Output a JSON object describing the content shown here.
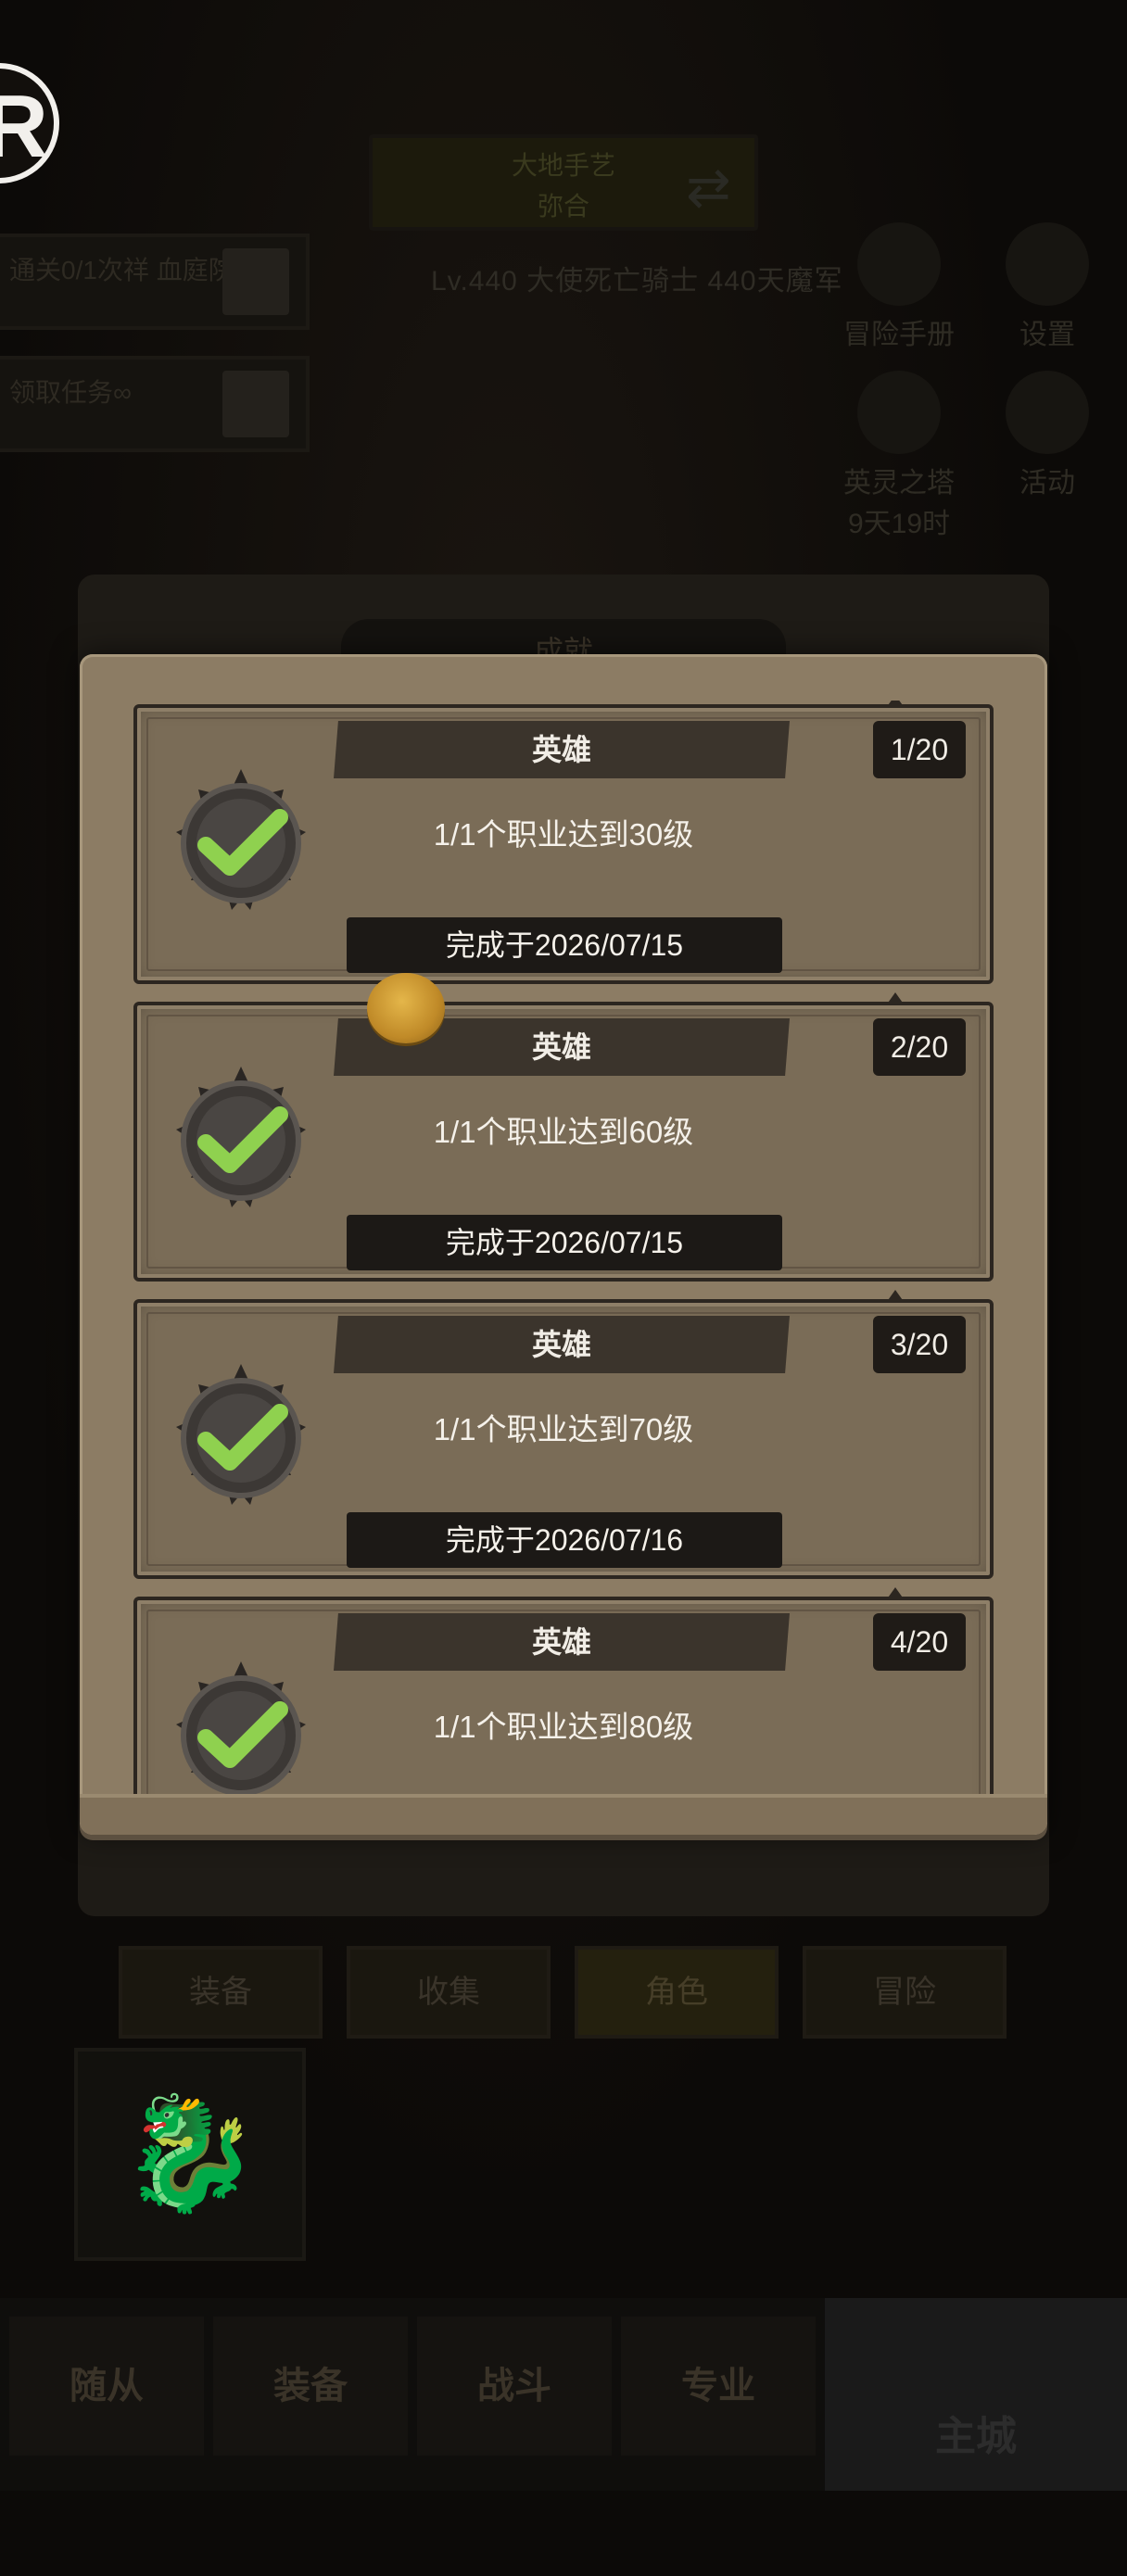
{
  "background": {
    "logo_letter": "R",
    "top_banner": [
      "大地手艺",
      "弥合"
    ],
    "quests": [
      "通关0/1次祥 血庭院",
      "领取任务∞"
    ],
    "hero_info": "Lv.440 大使死亡骑士   440天魔军",
    "side_buttons": [
      "冒险手册",
      "设置",
      "英灵之塔 9天19时",
      "活动"
    ],
    "panel_title": "成就",
    "nav_tabs": [
      {
        "label": "装备",
        "selected": false
      },
      {
        "label": "收集",
        "selected": false
      },
      {
        "label": "角色",
        "selected": true
      },
      {
        "label": "冒险",
        "selected": false
      }
    ],
    "bottom_bar": [
      "随从",
      "装备",
      "战斗",
      "专业"
    ],
    "main_city": "主城"
  },
  "achievements": [
    {
      "title": "英雄",
      "count": "1/20",
      "desc": "1/1个职业达到30级",
      "date": "完成于2026/07/15",
      "completed": true
    },
    {
      "title": "英雄",
      "count": "2/20",
      "desc": "1/1个职业达到60级",
      "date": "完成于2026/07/15",
      "completed": true
    },
    {
      "title": "英雄",
      "count": "3/20",
      "desc": "1/1个职业达到70级",
      "date": "完成于2026/07/16",
      "completed": true
    },
    {
      "title": "英雄",
      "count": "4/20",
      "desc": "1/1个职业达到80级",
      "date": "",
      "completed": true
    }
  ],
  "colors": {
    "check_green": "#8fd14f",
    "panel": "#8c7c64",
    "card": "#7a6c57",
    "label_dark": "#1c1916"
  }
}
